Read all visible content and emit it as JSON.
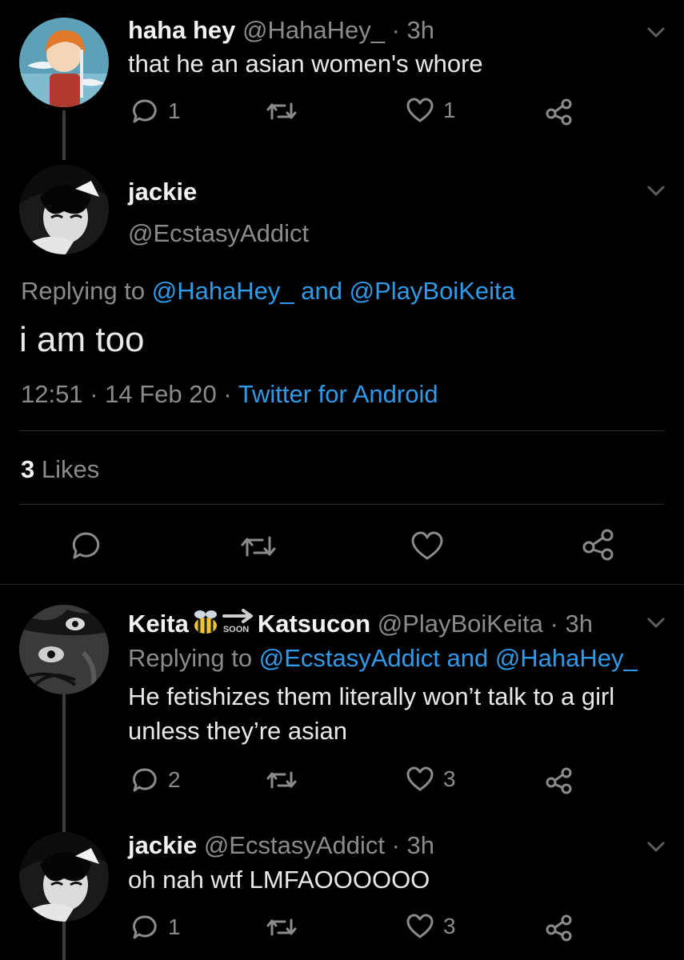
{
  "tweet1": {
    "name": "haha hey",
    "handle": "@HahaHey_",
    "time": "· 3h",
    "text": "that he an asian women's whore",
    "replies": "1",
    "likes": "1"
  },
  "main": {
    "name": "jackie",
    "handle": "@EcstasyAddict",
    "replying_prefix": "Replying to",
    "replying_to": "@HahaHey_ and @PlayBoiKeita",
    "text": "i am too",
    "timestamp": "12:51 · 14 Feb 20 ·",
    "source": "Twitter for Android",
    "likes_count": "3",
    "likes_label": "Likes"
  },
  "tweet3": {
    "name": "Keita",
    "name_emoji_caption": "SOON",
    "name_suffix": "Katsucon",
    "handle": "@PlayBoiKeita",
    "time": "· 3h",
    "replying_prefix": "Replying to",
    "replying_to": "@EcstasyAddict and @HahaHey_",
    "text_line1": "He fetishizes them literally won’t talk to a girl",
    "text_line2": "unless they’re asian",
    "replies": "2",
    "likes": "3"
  },
  "tweet4": {
    "name": "jackie",
    "handle": "@EcstasyAddict",
    "time": "· 3h",
    "text": "oh nah wtf LMFAOOOOOO",
    "replies": "1",
    "likes": "3"
  },
  "colors": {
    "background": "#000000",
    "link": "#2f9be8",
    "muted": "#8b8b8b",
    "separator": "#2b2b2b"
  },
  "icons": [
    "reply-icon",
    "retweet-icon",
    "like-icon",
    "share-icon",
    "chevron-down-icon",
    "bee-emoji-icon",
    "soon-arrow-emoji-icon"
  ]
}
